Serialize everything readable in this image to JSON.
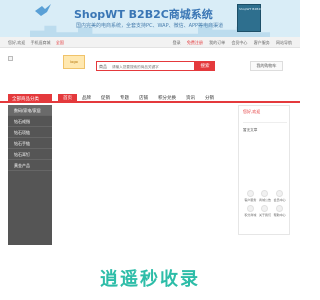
{
  "banner": {
    "title": "ShopWT B2B2C商城系统",
    "subtitle": "国内完美的电商系统，全套支持PC、WAP、微信、APP等电商渠道",
    "box_label": "ShopWT B2B2C"
  },
  "topbar": {
    "left": [
      "您好,欢迎",
      "手机逛商城",
      "全国"
    ],
    "right": [
      "登录",
      "免费注册",
      "我的订单",
      "会员中心",
      "客户服务",
      "网站导航"
    ]
  },
  "logo": {
    "text": "logo"
  },
  "search": {
    "category": "商品",
    "placeholder": "请输入您要搜索的商品关键字",
    "button_label": "搜索",
    "cart_label": "我的购物车"
  },
  "nav": {
    "category_header": "全部商品分类",
    "links": [
      "首页",
      "品牌",
      "促销",
      "专题",
      "店铺",
      "积分兑换",
      "资讯",
      "分销"
    ]
  },
  "sidebar": {
    "items": [
      "数码/家电/家居",
      "钻石戒指",
      "钻石项链",
      "钻石手链",
      "钻石耳钉",
      "黄金产品"
    ]
  },
  "cards": {
    "login_label": "您好,欢迎",
    "notice_text": "暂无文章",
    "grid": [
      "客户服务",
      "商城公告",
      "会员中心",
      "积分商城",
      "关于我们",
      "帮助中心"
    ]
  },
  "watermark": {
    "text": "逍遥秒收录"
  },
  "colors": {
    "accent": "#e4393c",
    "sidebar_bg": "#555555",
    "banner_bg": "#d9edf7",
    "watermark": "#2dbda8"
  }
}
